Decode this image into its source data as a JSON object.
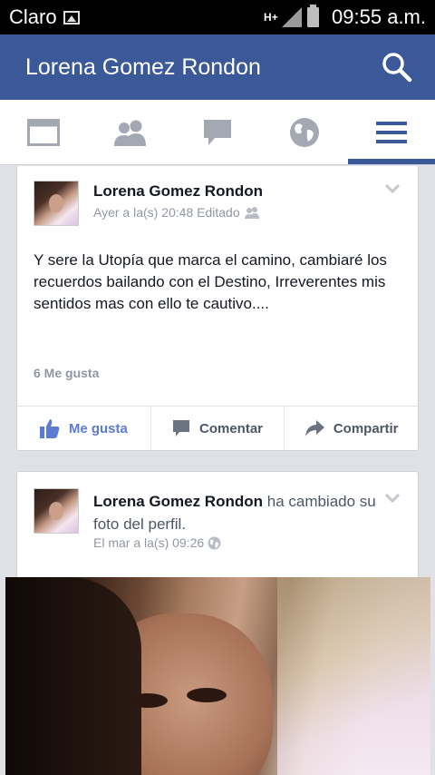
{
  "status_bar": {
    "carrier": "Claro",
    "network_type_top": "H+",
    "time": "09:55 a.m."
  },
  "header": {
    "title": "Lorena Gomez Rondon",
    "search_icon": "search-icon"
  },
  "tabs": [
    {
      "icon": "news-feed-icon",
      "active": false
    },
    {
      "icon": "friends-icon",
      "active": false
    },
    {
      "icon": "messages-icon",
      "active": false
    },
    {
      "icon": "globe-icon",
      "active": false
    },
    {
      "icon": "menu-icon",
      "active": true
    }
  ],
  "posts": [
    {
      "author": "Lorena Gomez Rondon",
      "meta": "Ayer a la(s) 20:48 Editado",
      "privacy_icon": "friends-icon",
      "text": "Y sere la Utopía que marca el camino, cambiaré  los recuerdos bailando con el Destino, Irreverentes mis sentidos mas con ello te cautivo....",
      "likes": "6 Me gusta",
      "actions": {
        "like": "Me gusta",
        "comment": "Comentar",
        "share": "Compartir"
      }
    },
    {
      "author": "Lorena Gomez Rondon",
      "action_text": "ha cambiado su foto del perfil.",
      "meta": "El mar a la(s) 09:26",
      "privacy_icon": "globe-icon"
    }
  ],
  "colors": {
    "brand": "#3b5998",
    "like_blue": "#5b7bd5",
    "meta_gray": "#9197a3",
    "background": "#dfe1e6"
  }
}
